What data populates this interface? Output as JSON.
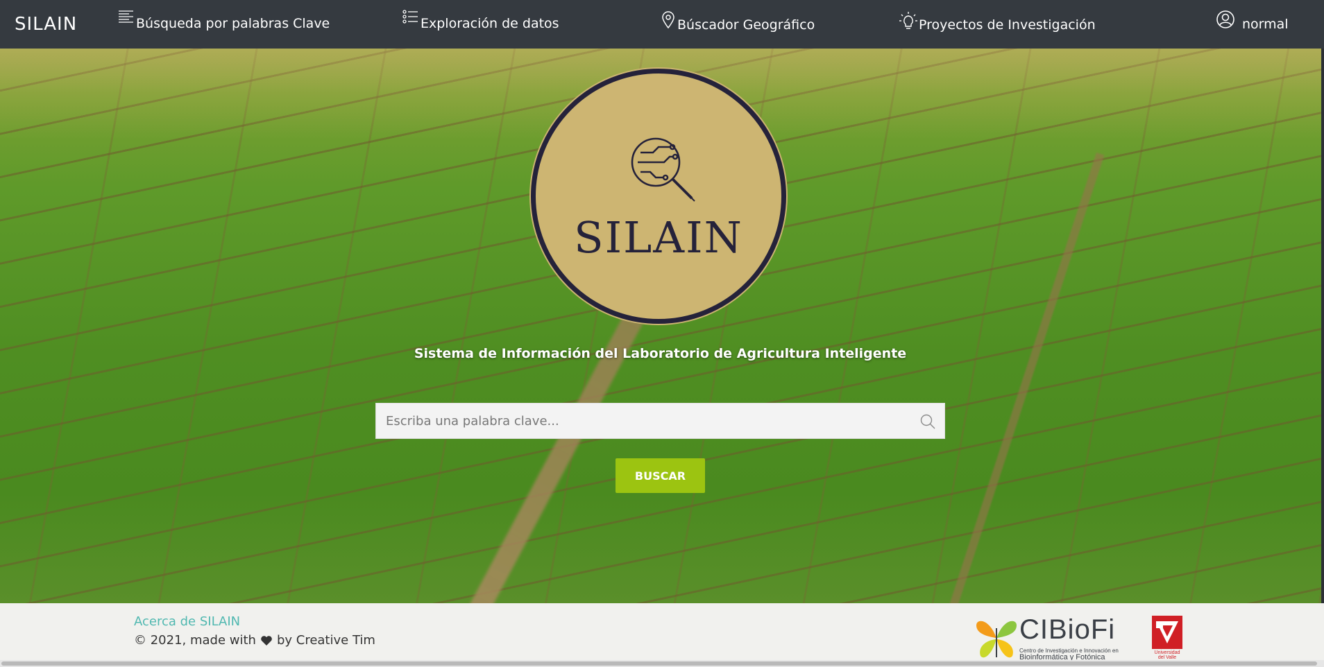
{
  "navbar": {
    "brand": "SILAIN",
    "items": [
      {
        "label": "Búsqueda por palabras Clave",
        "icon": "text-lines-icon"
      },
      {
        "label": "Exploración de datos",
        "icon": "list-icon"
      },
      {
        "label": "Búscador Geográfico",
        "icon": "map-pin-icon"
      },
      {
        "label": "Proyectos de Investigación",
        "icon": "lightbulb-icon"
      }
    ],
    "user": {
      "label": "normal",
      "icon": "user-circle-icon"
    }
  },
  "hero": {
    "logo_text": "SILAIN",
    "subtitle": "Sistema de Información del Laboratorio de Agricultura Inteligente",
    "search": {
      "placeholder": "Escriba una palabra clave...",
      "value": ""
    },
    "button_label": "BUSCAR",
    "colors": {
      "logo_bg": "#cdb572",
      "logo_ink": "#25223a",
      "button": "#9cc411"
    }
  },
  "footer": {
    "about_link": "Acerca de SILAIN",
    "copyright_prefix": "© 2021, made with",
    "copyright_suffix": "by Creative Tim",
    "partners": {
      "cibiofi_name": "CIBioFi",
      "cibiofi_tagline_1": "Centro de Investigación e Innovación en",
      "cibiofi_tagline_2": "Bioinformática y Fotónica",
      "univalle_1": "Universidad",
      "univalle_2": "del Valle"
    },
    "colors": {
      "link": "#50b8b0"
    }
  }
}
